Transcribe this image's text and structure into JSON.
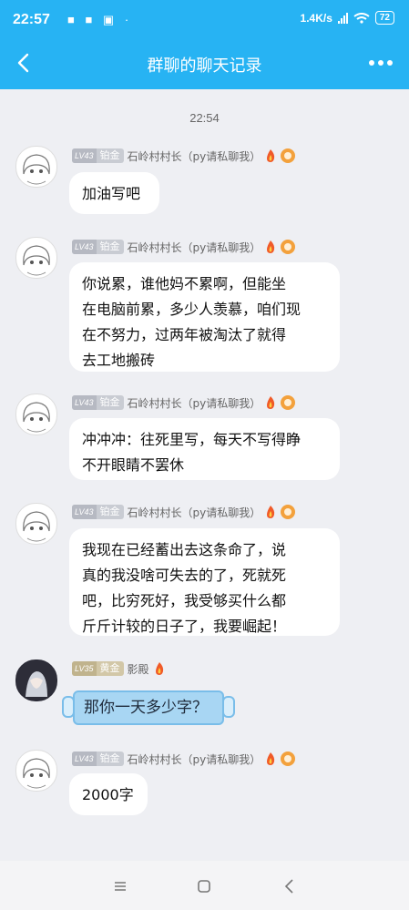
{
  "status_bar": {
    "time": "22:57",
    "speed": "1.4K/s",
    "battery": "72"
  },
  "header": {
    "title": "群聊的聊天记录"
  },
  "chat": {
    "timestamp": "22:54",
    "messages": [
      {
        "level": "LV43",
        "rank": "铂金",
        "sender": "石岭村村长（py请私聊我）",
        "text": "加油写吧"
      },
      {
        "level": "LV43",
        "rank": "铂金",
        "sender": "石岭村村长（py请私聊我）",
        "lines": [
          "你说累，谁他妈不累啊，但能坐",
          "在电脑前累，多少人羡慕，咱们现",
          "在不努力，过两年被淘汰了就得",
          "去工地搬砖"
        ]
      },
      {
        "level": "LV43",
        "rank": "铂金",
        "sender": "石岭村村长（py请私聊我）",
        "lines": [
          "冲冲冲：往死里写，每天不写得睁",
          "不开眼睛不罢休"
        ]
      },
      {
        "level": "LV43",
        "rank": "铂金",
        "sender": "石岭村村长（py请私聊我）",
        "lines": [
          "我现在已经蓄出去这条命了，说",
          "真的我没啥可失去的了，死就死",
          "吧，比穷死好，我受够买什么都",
          "斤斤计较的日子了，我要崛起！"
        ]
      },
      {
        "level": "LV35",
        "rank": "黄金",
        "sender": "影殿",
        "text": "那你一天多少字？"
      },
      {
        "level": "LV43",
        "rank": "铂金",
        "sender": "石岭村村长（py请私聊我）",
        "text": "2000字"
      }
    ]
  },
  "colors": {
    "accent": "#27b3f3",
    "background": "#eeeff3",
    "blue_bubble": "#a8d6f3"
  }
}
